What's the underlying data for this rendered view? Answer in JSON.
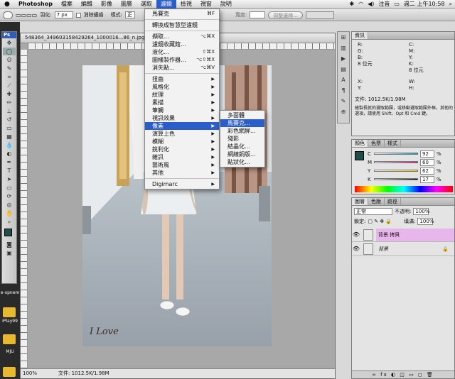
{
  "menubar": {
    "apple_icon": "apple-icon",
    "app_name": "Photoshop",
    "items": [
      "檔案",
      "編輯",
      "影像",
      "圖層",
      "選取",
      "濾鏡",
      "檢視",
      "視窗",
      "說明"
    ],
    "active_index": 5,
    "input_method": "注音",
    "clock": "週二 上午10:58"
  },
  "options": {
    "feather_label": "羽化:",
    "feather_value": "7 px",
    "antialias_label": "消除鋸齒",
    "style_label": "樣式:",
    "style_value": "正常",
    "width_label": "寬度:",
    "refine_button": "調整邊緣..."
  },
  "tools_header": "Ps",
  "document": {
    "title": "548364_349603158429264_1000016...86_n.jpg @ 100% (背景 拷貝, RGB/8)",
    "zoom": "100%",
    "status": "文件: 1012.5K/1.98M"
  },
  "photo": {
    "signature": "I Love"
  },
  "desktop_labels": [
    "e-xpnem",
    "iPlay99",
    "MJU"
  ],
  "filter_menu": {
    "items": [
      {
        "label": "馬賽克",
        "shortcut": "⌘F"
      },
      {
        "sep": true
      },
      {
        "label": "轉換成智慧型濾鏡",
        "shortcut": ""
      },
      {
        "sep": true
      },
      {
        "label": "擷取...",
        "shortcut": "⌥⌘X"
      },
      {
        "label": "濾鏡收藏館...",
        "shortcut": ""
      },
      {
        "label": "液化...",
        "shortcut": "⇧⌘X"
      },
      {
        "label": "圖樣製作器...",
        "shortcut": "⌥⇧⌘X"
      },
      {
        "label": "消失點...",
        "shortcut": "⌥⌘V"
      },
      {
        "sep": true
      },
      {
        "label": "扭曲",
        "submenu": true
      },
      {
        "label": "風格化",
        "submenu": true
      },
      {
        "label": "紋理",
        "submenu": true
      },
      {
        "label": "素描",
        "submenu": true
      },
      {
        "label": "筆觸",
        "submenu": true
      },
      {
        "label": "視訊效果",
        "submenu": true
      },
      {
        "label": "像素",
        "submenu": true,
        "highlight": true
      },
      {
        "label": "演算上色",
        "submenu": true
      },
      {
        "label": "模糊",
        "submenu": true
      },
      {
        "label": "銳利化",
        "submenu": true
      },
      {
        "label": "雜訊",
        "submenu": true
      },
      {
        "label": "藝術風",
        "submenu": true
      },
      {
        "label": "其他",
        "submenu": true
      },
      {
        "sep": true
      },
      {
        "label": "Digimarc",
        "submenu": true
      }
    ]
  },
  "pixel_submenu": {
    "items": [
      {
        "label": "多面體"
      },
      {
        "label": "馬賽克...",
        "highlight": true
      },
      {
        "label": "彩色網屏..."
      },
      {
        "label": "殘影"
      },
      {
        "label": "結晶化..."
      },
      {
        "label": "網線銅版..."
      },
      {
        "label": "點狀化..."
      }
    ]
  },
  "info_panel": {
    "tab": "資訊",
    "rows_left": [
      "R:",
      "G:",
      "B:",
      "8 位元"
    ],
    "rows_right": [
      "C:",
      "M:",
      "Y:",
      "K:",
      "8 位元"
    ],
    "xy_left": [
      "X:",
      "Y:"
    ],
    "xy_right": [
      "W:",
      "H:"
    ],
    "doc_line": "文件: 1012.5K/1.98M",
    "hint": "繪製長就的選取範圍，或移動選取範圍外框。其他的選項，請使用 Shift、Opt 和 Cmd 鍵。"
  },
  "color_panel": {
    "tabs": [
      "顏色",
      "色票",
      "樣式"
    ],
    "channels": [
      {
        "label": "C",
        "value": "92",
        "unit": "%"
      },
      {
        "label": "M",
        "value": "60",
        "unit": "%"
      },
      {
        "label": "Y",
        "value": "62",
        "unit": "%"
      },
      {
        "label": "K",
        "value": "17",
        "unit": "%"
      }
    ],
    "foreground": "#1f4f4d"
  },
  "layers_panel": {
    "tabs": [
      "圖層",
      "色版",
      "路徑"
    ],
    "blend_mode": "正常",
    "opacity_label": "不透明:",
    "opacity_value": "100%",
    "lock_label": "鎖定:",
    "fill_label": "填滿:",
    "fill_value": "100%",
    "layers": [
      {
        "name": "背景 拷貝",
        "selected": true
      },
      {
        "name": "背景",
        "italic": true
      }
    ],
    "footer": "∞ fx ◐ ◫ ▭ ◻ 🗑"
  },
  "colors": {
    "menu_highlight": "#2c5ec9",
    "layer_selected": "#e7b6ea"
  }
}
